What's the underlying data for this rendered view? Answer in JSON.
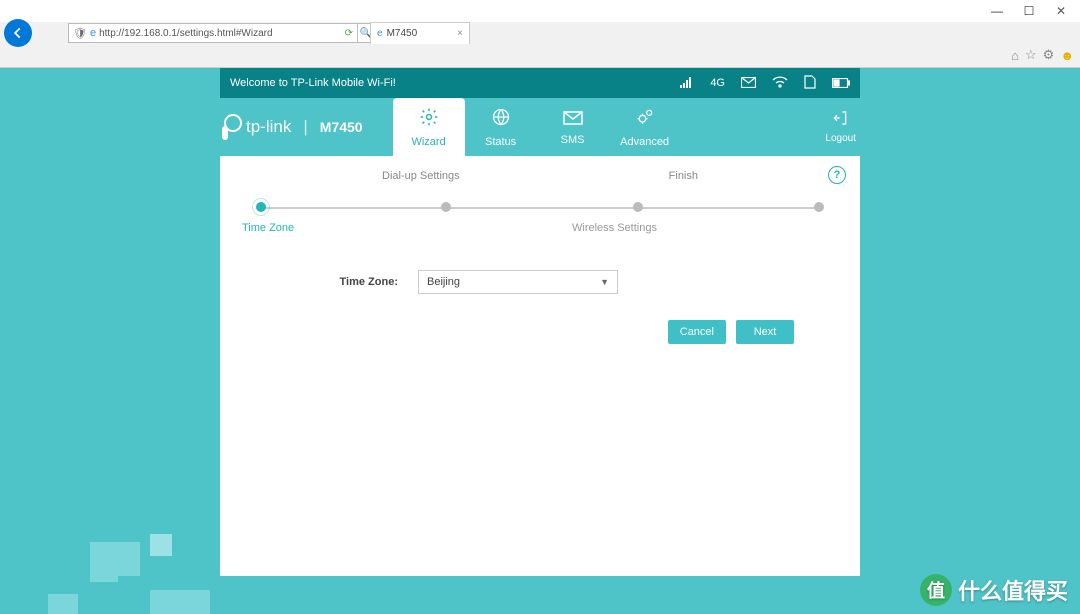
{
  "browser": {
    "url": "http://192.168.0.1/settings.html#Wizard",
    "tab_title": "M7450",
    "window_controls": {
      "min": "—",
      "max": "☐",
      "close": "✕"
    }
  },
  "topbar": {
    "welcome": "Welcome to TP-Link Mobile Wi-Fi!",
    "signal_label": "4G"
  },
  "brand": {
    "name": "tp-link",
    "model": "M7450"
  },
  "nav": {
    "wizard": "Wizard",
    "status": "Status",
    "sms": "SMS",
    "advanced": "Advanced",
    "logout": "Logout"
  },
  "wizard": {
    "crumb_dialup": "Dial-up Settings",
    "crumb_finish": "Finish",
    "steps": {
      "s1": "Time Zone",
      "s2": "",
      "s3": "Wireless Settings",
      "s4": ""
    },
    "field_label": "Time Zone:",
    "field_value": "Beijing",
    "btn_cancel": "Cancel",
    "btn_next": "Next"
  },
  "watermark": "什么值得买"
}
